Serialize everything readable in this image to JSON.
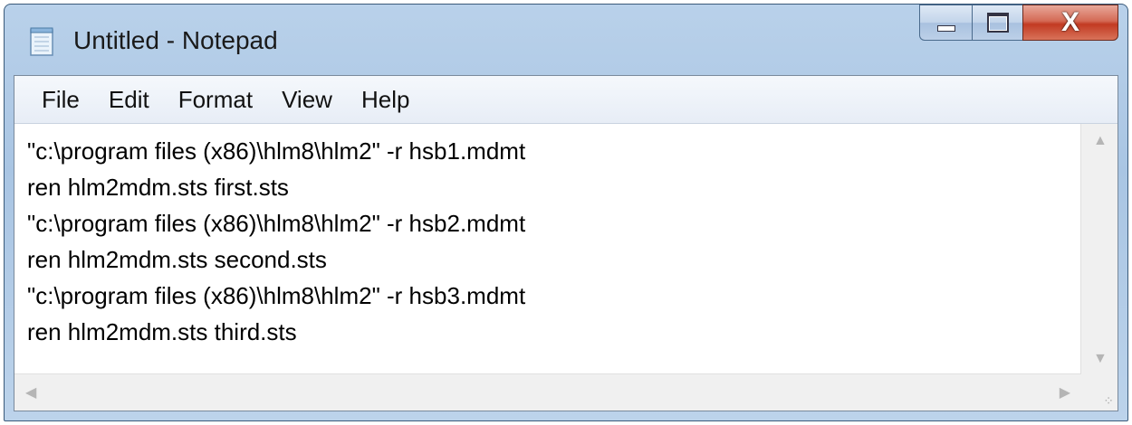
{
  "window": {
    "title": "Untitled - Notepad",
    "close_glyph": "X"
  },
  "menu": {
    "items": [
      "File",
      "Edit",
      "Format",
      "View",
      "Help"
    ]
  },
  "editor": {
    "lines": [
      "\"c:\\program files (x86)\\hlm8\\hlm2\" -r hsb1.mdmt",
      "ren hlm2mdm.sts first.sts",
      "\"c:\\program files (x86)\\hlm8\\hlm2\" -r hsb2.mdmt",
      "ren hlm2mdm.sts second.sts",
      "\"c:\\program files (x86)\\hlm8\\hlm2\" -r hsb3.mdmt",
      "ren hlm2mdm.sts third.sts"
    ]
  },
  "icons": {
    "app": "notepad-icon",
    "minimize": "minimize-icon",
    "maximize": "maximize-icon",
    "close": "close-icon",
    "scroll_up": "scroll-up-arrow-icon",
    "scroll_down": "scroll-down-arrow-icon",
    "scroll_left": "scroll-left-arrow-icon",
    "scroll_right": "scroll-right-arrow-icon",
    "resize": "resize-grip-icon"
  }
}
